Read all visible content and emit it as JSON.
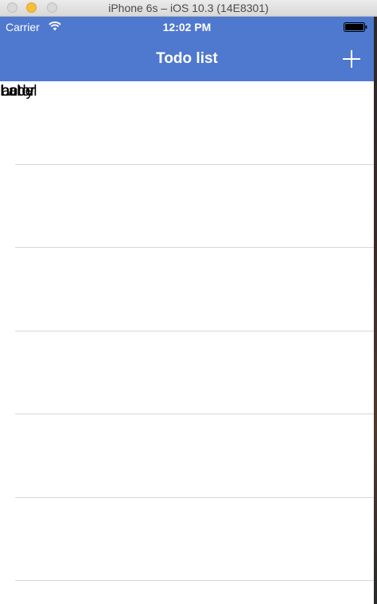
{
  "window": {
    "title": "iPhone 6s – iOS 10.3 (14E8301)"
  },
  "status_bar": {
    "carrier": "Carrier",
    "time": "12:02 PM",
    "wifi_icon": "wifi-icon",
    "battery_icon": "battery-icon"
  },
  "nav_bar": {
    "title": "Todo list",
    "add_icon": "plus-icon",
    "color": "#4f78cf"
  },
  "table": {
    "overlapping_labels": [
      "Label",
      "body",
      "actor"
    ],
    "row_count": 6
  }
}
